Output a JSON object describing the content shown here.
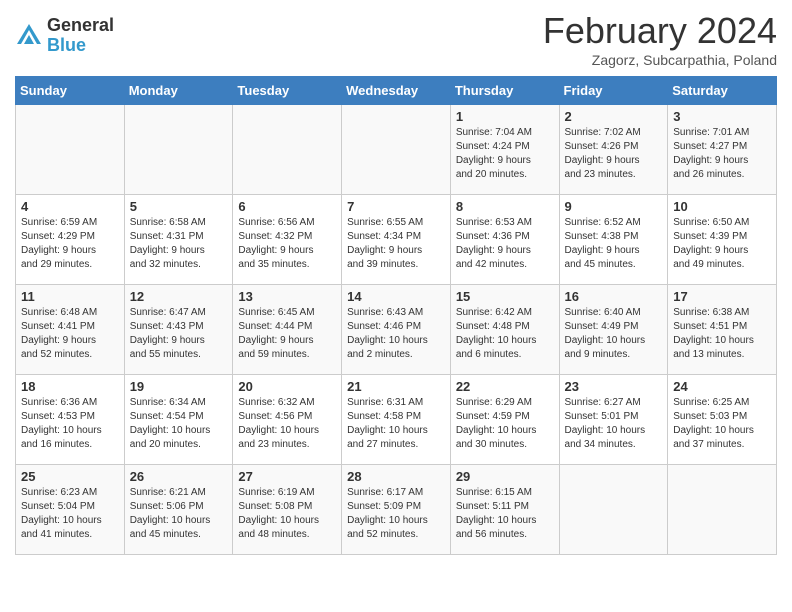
{
  "header": {
    "logo_general": "General",
    "logo_blue": "Blue",
    "month_title": "February 2024",
    "subtitle": "Zagorz, Subcarpathia, Poland"
  },
  "days_of_week": [
    "Sunday",
    "Monday",
    "Tuesday",
    "Wednesday",
    "Thursday",
    "Friday",
    "Saturday"
  ],
  "weeks": [
    [
      {
        "day": "",
        "info": ""
      },
      {
        "day": "",
        "info": ""
      },
      {
        "day": "",
        "info": ""
      },
      {
        "day": "",
        "info": ""
      },
      {
        "day": "1",
        "info": "Sunrise: 7:04 AM\nSunset: 4:24 PM\nDaylight: 9 hours\nand 20 minutes."
      },
      {
        "day": "2",
        "info": "Sunrise: 7:02 AM\nSunset: 4:26 PM\nDaylight: 9 hours\nand 23 minutes."
      },
      {
        "day": "3",
        "info": "Sunrise: 7:01 AM\nSunset: 4:27 PM\nDaylight: 9 hours\nand 26 minutes."
      }
    ],
    [
      {
        "day": "4",
        "info": "Sunrise: 6:59 AM\nSunset: 4:29 PM\nDaylight: 9 hours\nand 29 minutes."
      },
      {
        "day": "5",
        "info": "Sunrise: 6:58 AM\nSunset: 4:31 PM\nDaylight: 9 hours\nand 32 minutes."
      },
      {
        "day": "6",
        "info": "Sunrise: 6:56 AM\nSunset: 4:32 PM\nDaylight: 9 hours\nand 35 minutes."
      },
      {
        "day": "7",
        "info": "Sunrise: 6:55 AM\nSunset: 4:34 PM\nDaylight: 9 hours\nand 39 minutes."
      },
      {
        "day": "8",
        "info": "Sunrise: 6:53 AM\nSunset: 4:36 PM\nDaylight: 9 hours\nand 42 minutes."
      },
      {
        "day": "9",
        "info": "Sunrise: 6:52 AM\nSunset: 4:38 PM\nDaylight: 9 hours\nand 45 minutes."
      },
      {
        "day": "10",
        "info": "Sunrise: 6:50 AM\nSunset: 4:39 PM\nDaylight: 9 hours\nand 49 minutes."
      }
    ],
    [
      {
        "day": "11",
        "info": "Sunrise: 6:48 AM\nSunset: 4:41 PM\nDaylight: 9 hours\nand 52 minutes."
      },
      {
        "day": "12",
        "info": "Sunrise: 6:47 AM\nSunset: 4:43 PM\nDaylight: 9 hours\nand 55 minutes."
      },
      {
        "day": "13",
        "info": "Sunrise: 6:45 AM\nSunset: 4:44 PM\nDaylight: 9 hours\nand 59 minutes."
      },
      {
        "day": "14",
        "info": "Sunrise: 6:43 AM\nSunset: 4:46 PM\nDaylight: 10 hours\nand 2 minutes."
      },
      {
        "day": "15",
        "info": "Sunrise: 6:42 AM\nSunset: 4:48 PM\nDaylight: 10 hours\nand 6 minutes."
      },
      {
        "day": "16",
        "info": "Sunrise: 6:40 AM\nSunset: 4:49 PM\nDaylight: 10 hours\nand 9 minutes."
      },
      {
        "day": "17",
        "info": "Sunrise: 6:38 AM\nSunset: 4:51 PM\nDaylight: 10 hours\nand 13 minutes."
      }
    ],
    [
      {
        "day": "18",
        "info": "Sunrise: 6:36 AM\nSunset: 4:53 PM\nDaylight: 10 hours\nand 16 minutes."
      },
      {
        "day": "19",
        "info": "Sunrise: 6:34 AM\nSunset: 4:54 PM\nDaylight: 10 hours\nand 20 minutes."
      },
      {
        "day": "20",
        "info": "Sunrise: 6:32 AM\nSunset: 4:56 PM\nDaylight: 10 hours\nand 23 minutes."
      },
      {
        "day": "21",
        "info": "Sunrise: 6:31 AM\nSunset: 4:58 PM\nDaylight: 10 hours\nand 27 minutes."
      },
      {
        "day": "22",
        "info": "Sunrise: 6:29 AM\nSunset: 4:59 PM\nDaylight: 10 hours\nand 30 minutes."
      },
      {
        "day": "23",
        "info": "Sunrise: 6:27 AM\nSunset: 5:01 PM\nDaylight: 10 hours\nand 34 minutes."
      },
      {
        "day": "24",
        "info": "Sunrise: 6:25 AM\nSunset: 5:03 PM\nDaylight: 10 hours\nand 37 minutes."
      }
    ],
    [
      {
        "day": "25",
        "info": "Sunrise: 6:23 AM\nSunset: 5:04 PM\nDaylight: 10 hours\nand 41 minutes."
      },
      {
        "day": "26",
        "info": "Sunrise: 6:21 AM\nSunset: 5:06 PM\nDaylight: 10 hours\nand 45 minutes."
      },
      {
        "day": "27",
        "info": "Sunrise: 6:19 AM\nSunset: 5:08 PM\nDaylight: 10 hours\nand 48 minutes."
      },
      {
        "day": "28",
        "info": "Sunrise: 6:17 AM\nSunset: 5:09 PM\nDaylight: 10 hours\nand 52 minutes."
      },
      {
        "day": "29",
        "info": "Sunrise: 6:15 AM\nSunset: 5:11 PM\nDaylight: 10 hours\nand 56 minutes."
      },
      {
        "day": "",
        "info": ""
      },
      {
        "day": "",
        "info": ""
      }
    ]
  ]
}
